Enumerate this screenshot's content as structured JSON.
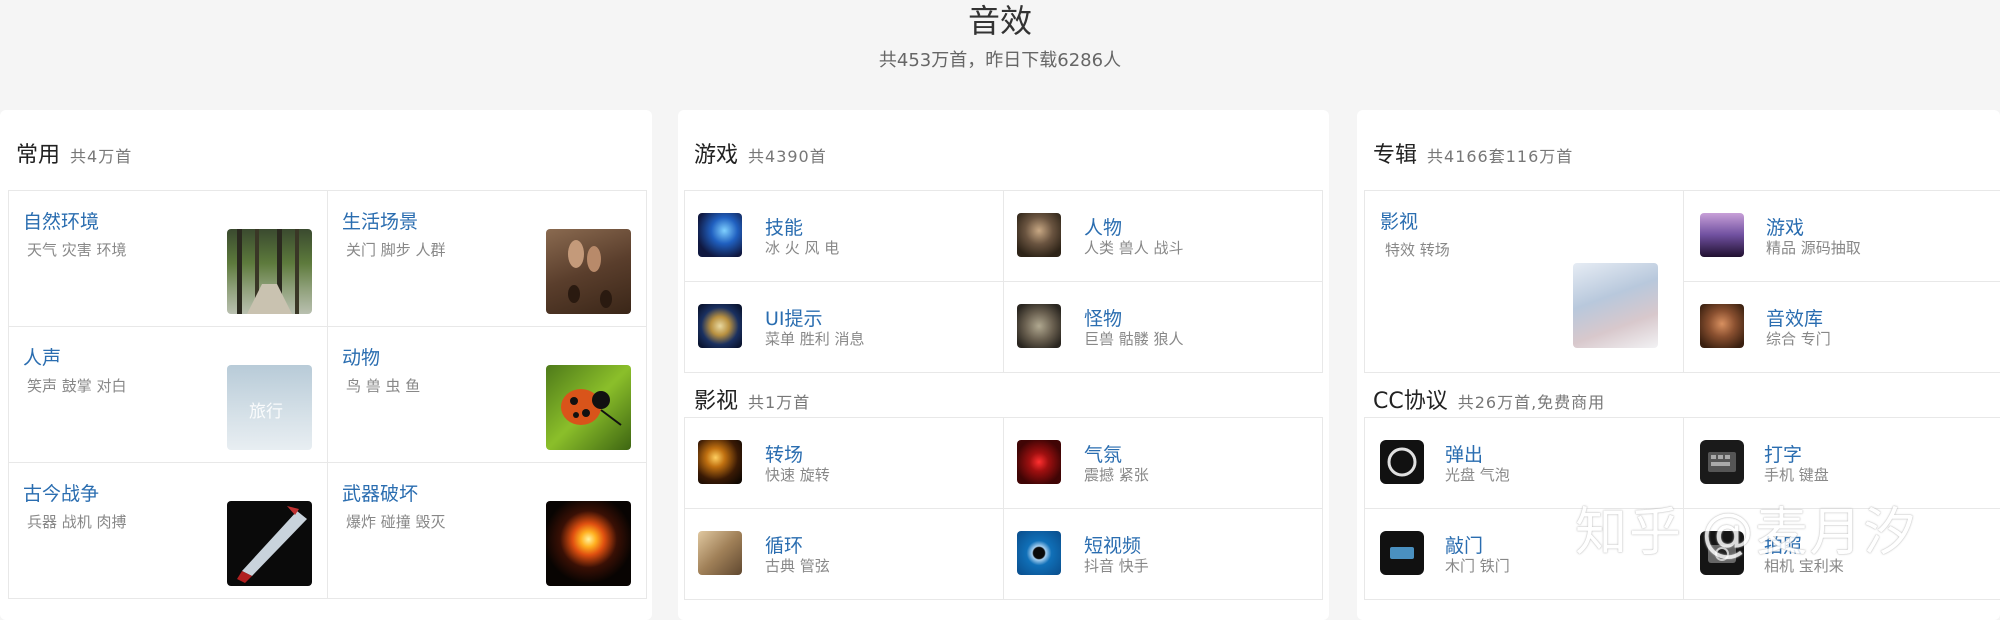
{
  "header": {
    "title": "音效",
    "subtitle": "共453万首，昨日下载6286人"
  },
  "panels": {
    "common": {
      "title": "常用",
      "count": "共4万首",
      "items": [
        {
          "title": "自然环境",
          "tags": "天气 灾害 环境"
        },
        {
          "title": "生活场景",
          "tags": "关门 脚步 人群"
        },
        {
          "title": "人声",
          "tags": "笑声 鼓掌 对白"
        },
        {
          "title": "动物",
          "tags": "鸟 兽 虫 鱼"
        },
        {
          "title": "古今战争",
          "tags": "兵器 战机 肉搏"
        },
        {
          "title": "武器破坏",
          "tags": "爆炸 碰撞 毁灭"
        }
      ],
      "thumb_text": "旅行"
    },
    "games": {
      "title": "游戏",
      "count": "共4390首",
      "items": [
        {
          "title": "技能",
          "tags": "冰 火 风 电"
        },
        {
          "title": "人物",
          "tags": "人类 兽人 战斗"
        },
        {
          "title": "UI提示",
          "tags": "菜单 胜利 消息"
        },
        {
          "title": "怪物",
          "tags": "巨兽 骷髅 狼人"
        }
      ]
    },
    "film": {
      "title": "影视",
      "count": "共1万首",
      "items": [
        {
          "title": "转场",
          "tags": "快速 旋转"
        },
        {
          "title": "气氛",
          "tags": "震撼 紧张"
        },
        {
          "title": "循环",
          "tags": "古典 管弦"
        },
        {
          "title": "短视频",
          "tags": "抖音 快手"
        }
      ]
    },
    "albums": {
      "title": "专辑",
      "count": "共4166套116万首",
      "items": [
        {
          "title": "影视",
          "tags": "特效 转场"
        },
        {
          "title": "游戏",
          "tags": "精品 源码抽取"
        },
        {
          "title": "音效库",
          "tags": "综合 专门"
        }
      ]
    },
    "cc": {
      "title": "CC协议",
      "count": "共26万首,免费商用",
      "items": [
        {
          "title": "弹出",
          "tags": "光盘 气泡"
        },
        {
          "title": "打字",
          "tags": "手机 键盘"
        },
        {
          "title": "敲门",
          "tags": "木门 铁门"
        },
        {
          "title": "拍照",
          "tags": "相机 宝利来"
        }
      ]
    }
  },
  "watermark": "知乎 @麦月汐",
  "colors": {
    "link": "#2a6db0",
    "background": "#f5f5f5",
    "panel": "#ffffff"
  }
}
